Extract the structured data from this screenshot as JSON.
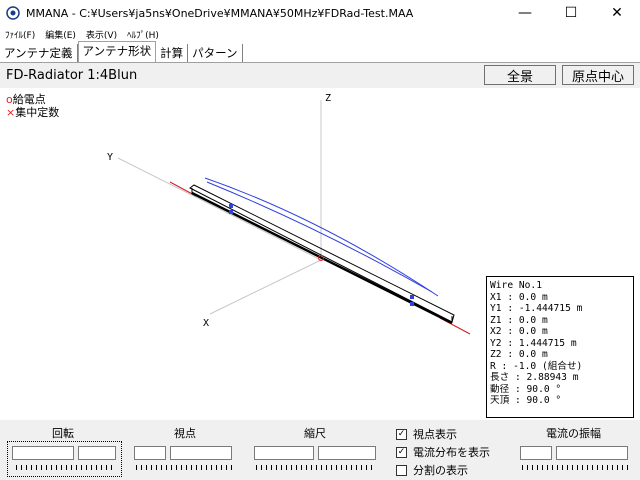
{
  "window": {
    "title": "MMANA - C:¥Users¥ja5ns¥OneDrive¥MMANA¥50MHz¥FDRad-Test.MAA",
    "minimize": "—",
    "maximize": "☐",
    "close": "✕"
  },
  "menu": [
    "ﾌｧｲﾙ(F)",
    "編集(E)",
    "表示(V)",
    "ﾍﾙﾌﾟ(H)"
  ],
  "tabs": [
    {
      "label": "アンテナ定義",
      "active": false
    },
    {
      "label": "アンテナ形状",
      "active": true
    },
    {
      "label": "計算",
      "active": false
    },
    {
      "label": "パターン",
      "active": false
    }
  ],
  "view": {
    "title": "FD-Radiator 1:4Blun",
    "btn_full": "全景",
    "btn_origin": "原点中心"
  },
  "legend": {
    "feed_symbol": "o",
    "feed_label": "給電点",
    "load_symbol": "×",
    "load_label": "集中定数"
  },
  "axes": {
    "z": "Z",
    "y": "Y",
    "x": "X"
  },
  "wire_info": [
    "Wire No.1",
    "X1   : 0.0 m",
    "Y1   : -1.444715 m",
    "Z1   : 0.0 m",
    "X2   : 0.0 m",
    "Y2   : 1.444715 m",
    "Z2   : 0.0 m",
    "R    : -1.0 (組合せ)",
    "長さ : 2.88943 m",
    "動径 : 90.0 °",
    "天頂 : 90.0 °"
  ],
  "controls": {
    "rotate": "回転",
    "viewpoint": "視点",
    "scale": "縮尺",
    "show_viewpoint": {
      "label": "視点表示",
      "checked": true
    },
    "show_current": {
      "label": "電流分布を表示",
      "checked": true
    },
    "show_segments": {
      "label": "分割の表示",
      "checked": false
    },
    "amplitude": "電流の振幅"
  },
  "colors": {
    "wire": "#000000",
    "current": "#2f3fe0",
    "axis_y": "#d02020",
    "feed": "#e02020"
  }
}
